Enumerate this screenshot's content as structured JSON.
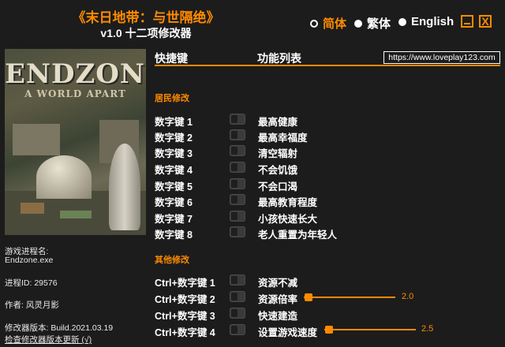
{
  "header": {
    "title": "《末日地带：与世隔绝》",
    "subtitle": "v1.0 十二项修改器"
  },
  "languages": [
    {
      "label": "简体",
      "selected": true
    },
    {
      "label": "繁体",
      "selected": false
    },
    {
      "label": "English",
      "selected": false
    }
  ],
  "window": {
    "minimize_icon": "minimize-icon",
    "close_label": "X"
  },
  "cover": {
    "logo": "ENDZONE",
    "tagline": "A WORLD APART"
  },
  "info": {
    "process_label": "游戏进程名:",
    "process_value": "Endzone.exe",
    "pid": "进程ID:  29576",
    "author": "作者:  风灵月影",
    "version": "修改器版本:  Build.2021.03.19",
    "check_update": "检查修改器版本更新 (√)"
  },
  "table": {
    "col_hotkey": "快捷键",
    "col_function": "功能列表",
    "url": "https://www.loveplay123.com"
  },
  "sections": {
    "residents": "居民修改",
    "other": "其他修改"
  },
  "resident_cheats": [
    {
      "key": "数字键 1",
      "name": "最高健康"
    },
    {
      "key": "数字键 2",
      "name": "最高幸福度"
    },
    {
      "key": "数字键 3",
      "name": "清空辐射"
    },
    {
      "key": "数字键 4",
      "name": "不会饥饿"
    },
    {
      "key": "数字键 5",
      "name": "不会口渴"
    },
    {
      "key": "数字键 6",
      "name": "最高教育程度"
    },
    {
      "key": "数字键 7",
      "name": "小孩快速长大"
    },
    {
      "key": "数字键 8",
      "name": "老人重置为年轻人"
    }
  ],
  "other_cheats": [
    {
      "key": "Ctrl+数字键 1",
      "name": "资源不减"
    },
    {
      "key": "Ctrl+数字键 2",
      "name": "资源倍率",
      "slider_value": "2.0",
      "slider_fraction": 0.05
    },
    {
      "key": "Ctrl+数字键 3",
      "name": "快速建造"
    },
    {
      "key": "Ctrl+数字键 4",
      "name": "设置游戏速度",
      "slider_value": "2.5",
      "slider_fraction": 0.05
    }
  ],
  "colors": {
    "accent": "#ff8a00",
    "background": "#1c1c1c",
    "text": "#ffffff"
  }
}
